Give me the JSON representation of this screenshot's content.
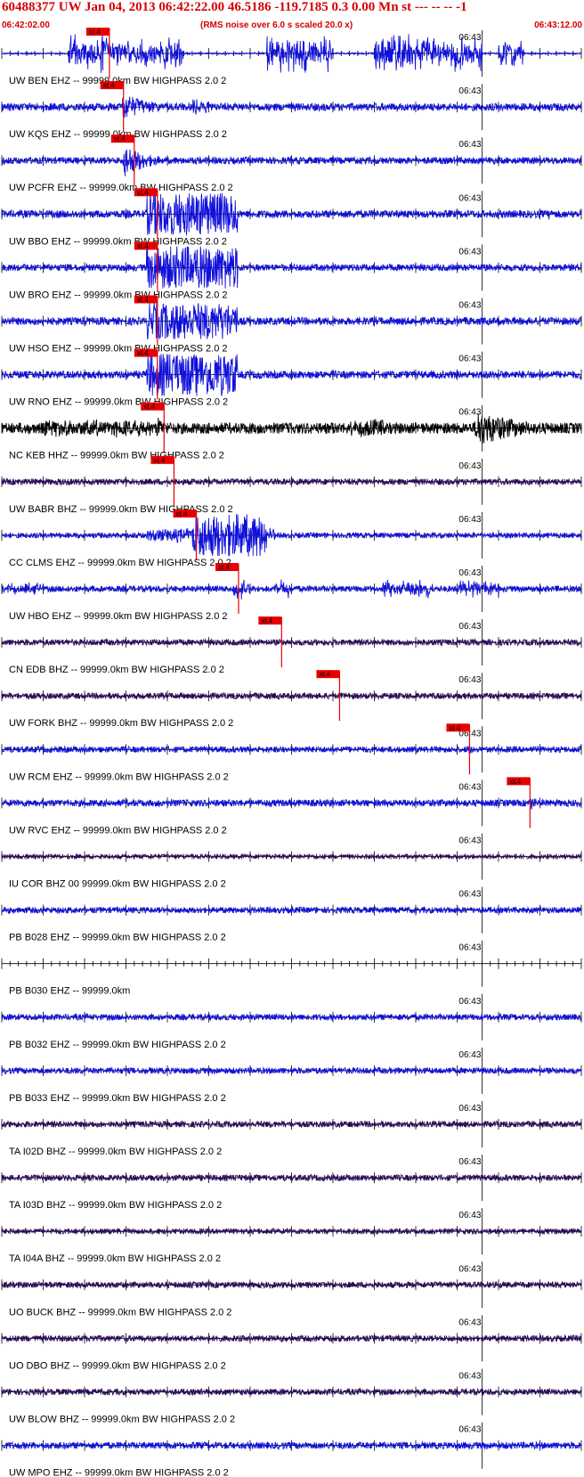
{
  "header": {
    "title": "60488377 UW Jan 04, 2013 06:42:22.00   46.5186 -119.7185  0.3 0.00 Mn st --- -- --  -1",
    "start_time": "06:42:02.00",
    "end_time": "06:43:12.00",
    "note": "(RMS noise over 6.0 s scaled 20.0 x)"
  },
  "chart_data": {
    "type": "line",
    "title": "60488377 UW Jan 04, 2013 06:42:22.00   46.5186 -119.7185  0.3 0.00 Mn st --- -- --  -1",
    "x_range": [
      "06:42:02.00",
      "06:43:12.00"
    ],
    "x_range_seconds": [
      0,
      70
    ],
    "minute_tick_label": "06:43",
    "pick_label": "xt.4",
    "colors": {
      "header": "#d40000",
      "pick": "#e60000",
      "blue": "#1010dd",
      "black": "#000000",
      "purple": "#2a0a5a",
      "axis": "#000000"
    },
    "traces": [
      {
        "label": "UW BEN EHZ -- 99999.0km BW  HIGHPASS  2.0  2",
        "color": "blue",
        "noise": 0.04,
        "pick": 13.0,
        "bursts": [
          [
            8,
            12.5,
            0.95,
            "s"
          ],
          [
            12.5,
            22,
            0.75,
            "s"
          ],
          [
            32,
            40,
            0.9,
            "s"
          ],
          [
            45,
            58,
            0.9,
            "s"
          ],
          [
            60,
            63,
            0.6,
            "s"
          ]
        ]
      },
      {
        "label": "UW KQS EHZ -- 99999.0km BW  HIGHPASS  2.0  2",
        "color": "blue",
        "noise": 0.18,
        "pick": 14.7,
        "bursts": [
          [
            14.2,
            23,
            0.7,
            "d"
          ],
          [
            23,
            25,
            0.4,
            "s"
          ]
        ]
      },
      {
        "label": "UW PCFR EHZ -- 99999.0km BW  HIGHPASS  2.0  2",
        "color": "blue",
        "noise": 0.16,
        "pick": 16.0,
        "bursts": [
          [
            14.5,
            21,
            0.9,
            "d"
          ]
        ]
      },
      {
        "label": "UW BBO EHZ -- 99999.0km BW  HIGHPASS  2.0  2",
        "color": "blue",
        "noise": 0.18,
        "pick": 18.8,
        "bursts": [
          [
            17.5,
            28.5,
            1.0,
            "c"
          ],
          [
            66,
            66.5,
            0.5,
            "s"
          ]
        ]
      },
      {
        "label": "UW BRO EHZ -- 99999.0km BW  HIGHPASS  2.0  2",
        "color": "blue",
        "noise": 0.16,
        "pick": 18.8,
        "bursts": [
          [
            17.5,
            28.5,
            1.0,
            "c"
          ]
        ]
      },
      {
        "label": "UW HSO EHZ -- 99999.0km BW  HIGHPASS  2.0  2",
        "color": "blue",
        "noise": 0.18,
        "pick": 18.8,
        "bursts": [
          [
            17.5,
            28.5,
            0.85,
            "c"
          ]
        ]
      },
      {
        "label": "UW RNO EHZ -- 99999.0km BW  HIGHPASS  2.0  2",
        "color": "blue",
        "noise": 0.18,
        "pick": 18.8,
        "bursts": [
          [
            17.5,
            28.5,
            1.0,
            "c"
          ]
        ]
      },
      {
        "label": "NC KEB HHZ -- 99999.0km BW  HIGHPASS  2.0  2",
        "color": "black",
        "noise": 0.26,
        "pick": 19.6,
        "bursts": [
          [
            5,
            18,
            0.45,
            "n"
          ],
          [
            18.5,
            21,
            0.8,
            "d"
          ],
          [
            42,
            46,
            0.45,
            "n"
          ],
          [
            57,
            70,
            0.95,
            "d"
          ]
        ]
      },
      {
        "label": "UW BABR BHZ -- 99999.0km BW  HIGHPASS  2.0  2",
        "color": "purple",
        "noise": 0.14,
        "pick": 20.8,
        "bursts": []
      },
      {
        "label": "CC CLMS EHZ -- 99999.0km BW  HIGHPASS  2.0  2",
        "color": "blue",
        "noise": 0.12,
        "pick": 23.5,
        "bursts": [
          [
            17.5,
            23,
            0.35,
            "n"
          ],
          [
            23,
            32,
            1.0,
            "c"
          ],
          [
            32,
            33,
            0.4,
            "s"
          ]
        ]
      },
      {
        "label": "UW HBO EHZ -- 99999.0km BW  HIGHPASS  2.0  2",
        "color": "blue",
        "noise": 0.14,
        "pick": 28.6,
        "bursts": [
          [
            0,
            5,
            0.3,
            "s"
          ],
          [
            28,
            30,
            0.5,
            "s"
          ],
          [
            33,
            35,
            0.45,
            "s"
          ],
          [
            46,
            52,
            0.45,
            "s"
          ],
          [
            55,
            60,
            0.45,
            "s"
          ]
        ]
      },
      {
        "label": "CN EDB BHZ -- 99999.0km BW  HIGHPASS  2.0  2",
        "color": "purple",
        "noise": 0.14,
        "pick": 33.8,
        "bursts": []
      },
      {
        "label": "UW FORK BHZ -- 99999.0km BW  HIGHPASS  2.0  2",
        "color": "purple",
        "noise": 0.14,
        "pick": 40.8,
        "bursts": []
      },
      {
        "label": "UW RCM EHZ -- 99999.0km BW  HIGHPASS  2.0  2",
        "color": "blue",
        "noise": 0.14,
        "pick": 56.5,
        "bursts": [
          [
            56,
            57.5,
            0.45,
            "d"
          ]
        ]
      },
      {
        "label": "UW RVC EHZ -- 99999.0km BW  HIGHPASS  2.0  2",
        "color": "blue",
        "noise": 0.16,
        "pick": 63.8,
        "bursts": [
          [
            63.5,
            66,
            0.5,
            "d"
          ]
        ]
      },
      {
        "label": "IU COR BHZ 00 99999.0km BW  HIGHPASS  2.0  2",
        "color": "purple",
        "noise": 0.1,
        "pick": null,
        "bursts": []
      },
      {
        "label": "PB B028 EHZ -- 99999.0km BW  HIGHPASS  2.0  2",
        "color": "blue",
        "noise": 0.14,
        "pick": null,
        "bursts": []
      },
      {
        "label": "PB B030 EHZ -- 99999.0km",
        "color": "blue",
        "noise": 0,
        "pick": null,
        "bursts": []
      },
      {
        "label": "PB B032 EHZ -- 99999.0km BW  HIGHPASS  2.0  2",
        "color": "blue",
        "noise": 0.14,
        "pick": null,
        "bursts": []
      },
      {
        "label": "PB B033 EHZ -- 99999.0km BW  HIGHPASS  2.0  2",
        "color": "blue",
        "noise": 0.14,
        "pick": null,
        "bursts": []
      },
      {
        "label": "TA I02D BHZ -- 99999.0km BW  HIGHPASS  2.0  2",
        "color": "purple",
        "noise": 0.14,
        "pick": null,
        "bursts": []
      },
      {
        "label": "TA I03D BHZ -- 99999.0km BW  HIGHPASS  2.0  2",
        "color": "purple",
        "noise": 0.14,
        "pick": null,
        "bursts": []
      },
      {
        "label": "TA I04A BHZ -- 99999.0km BW  HIGHPASS  2.0  2",
        "color": "purple",
        "noise": 0.12,
        "pick": null,
        "bursts": []
      },
      {
        "label": "UO BUCK BHZ -- 99999.0km BW  HIGHPASS  2.0  2",
        "color": "purple",
        "noise": 0.14,
        "pick": null,
        "bursts": []
      },
      {
        "label": "UO DBO BHZ -- 99999.0km BW  HIGHPASS  2.0  2",
        "color": "purple",
        "noise": 0.14,
        "pick": null,
        "bursts": []
      },
      {
        "label": "UW BLOW BHZ -- 99999.0km BW  HIGHPASS  2.0  2",
        "color": "purple",
        "noise": 0.14,
        "pick": null,
        "bursts": []
      },
      {
        "label": "UW MPO EHZ -- 99999.0km BW  HIGHPASS  2.0  2",
        "color": "blue",
        "noise": 0.16,
        "pick": null,
        "bursts": []
      }
    ]
  }
}
